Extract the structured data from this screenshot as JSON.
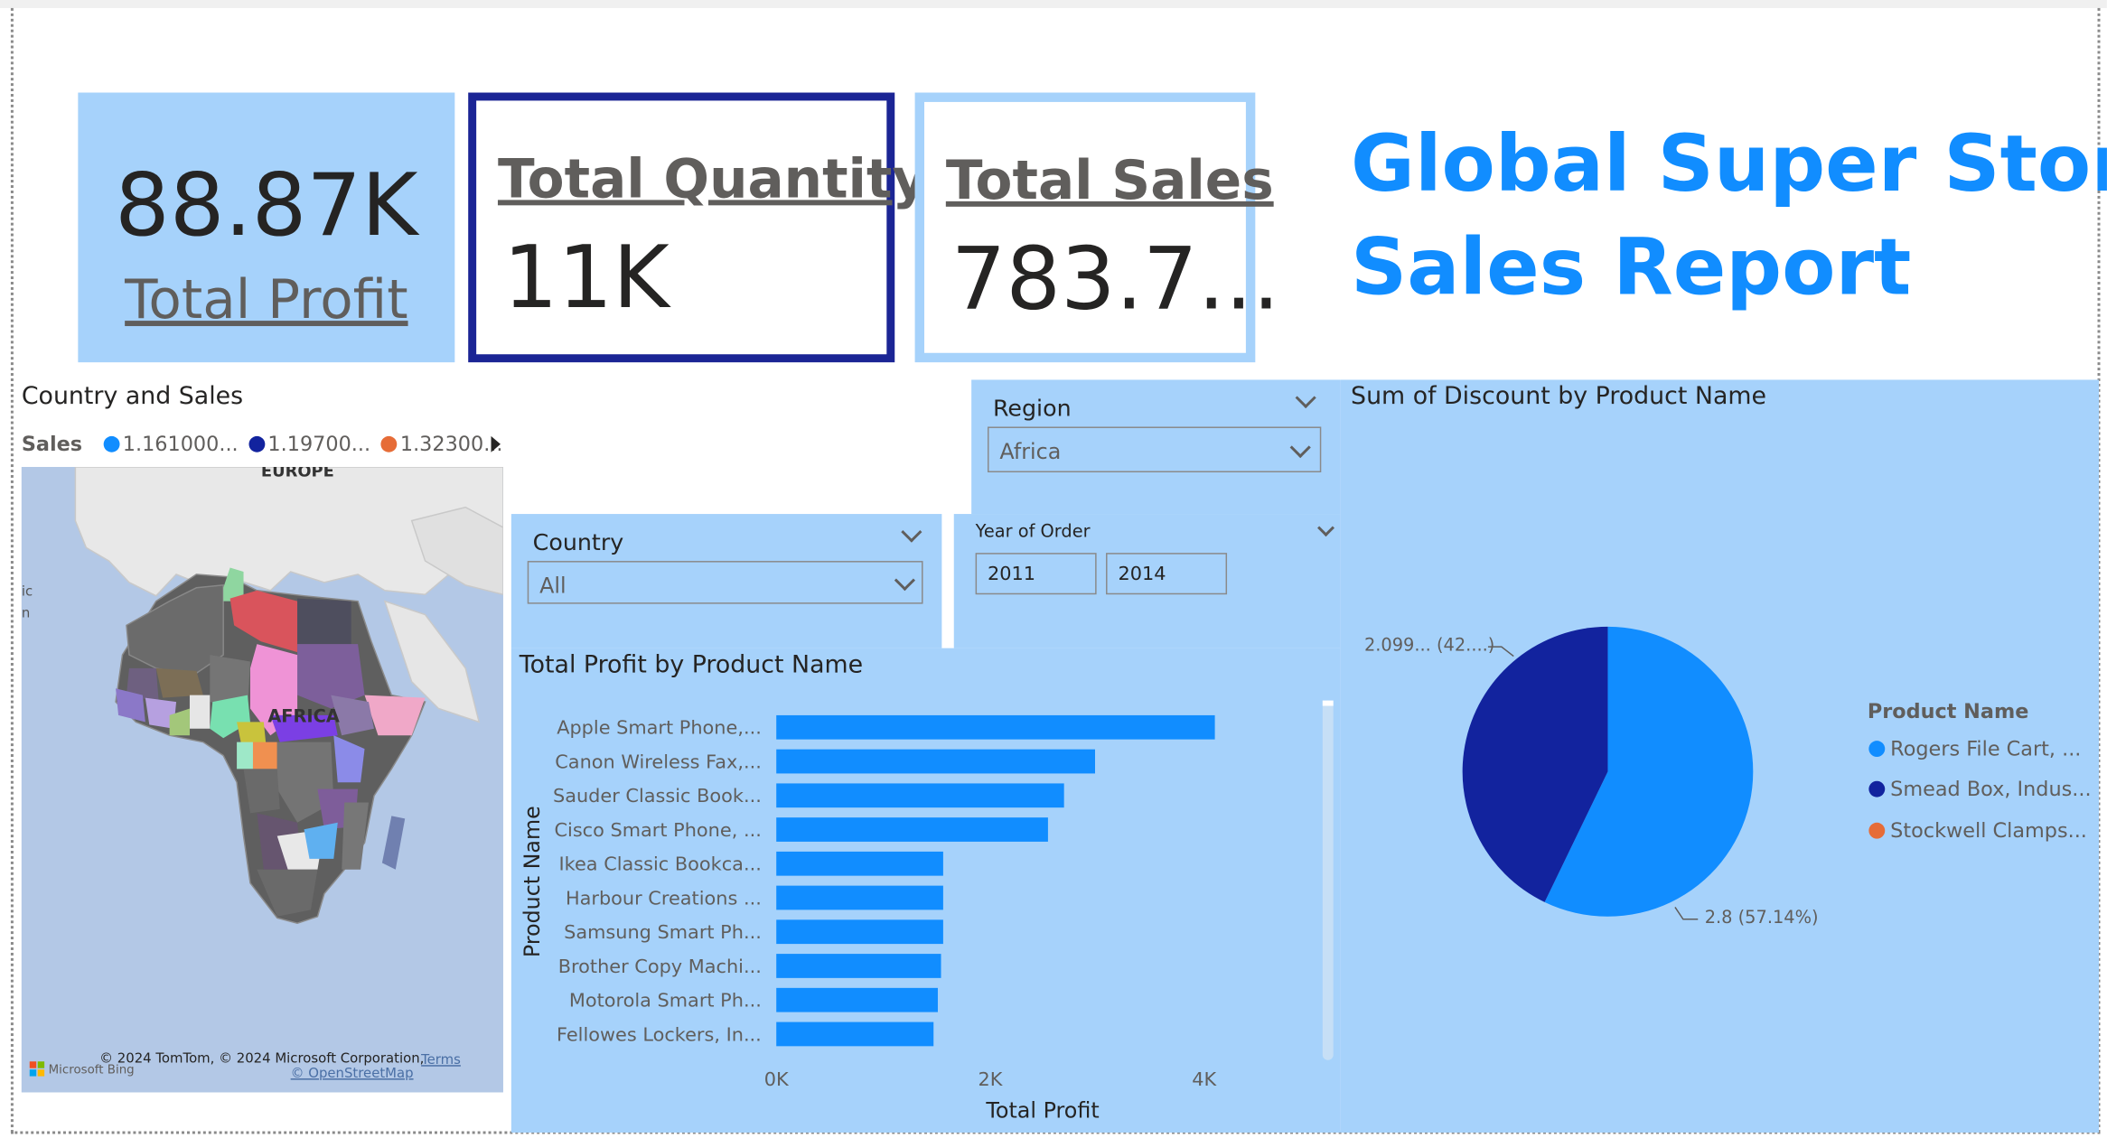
{
  "kpis": {
    "profit": {
      "value": "88.87K",
      "label": "Total Profit"
    },
    "quantity": {
      "label": "Total Quantity",
      "value": "11K"
    },
    "sales": {
      "label": "Total Sales",
      "value": "783.7..."
    }
  },
  "report_title": {
    "line1": "Global Super Store",
    "line2": "Sales Report"
  },
  "slicers": {
    "region": {
      "label": "Region",
      "value": "Africa"
    },
    "country": {
      "label": "Country",
      "value": "All"
    },
    "year": {
      "label": "Year of Order",
      "from": "2011",
      "to": "2014"
    }
  },
  "map": {
    "title": "Country and Sales",
    "legend_title": "Sales",
    "legend": [
      {
        "label": "1.161000...",
        "color": "#118dff"
      },
      {
        "label": "1.19700...",
        "color": "#12239e"
      },
      {
        "label": "1.32300...",
        "color": "#e66c37"
      }
    ],
    "place_labels": {
      "europe": "EUROPE",
      "africa": "AFRICA",
      "edge1": "ic",
      "edge2": "n"
    },
    "attribution": "© 2024 TomTom, © 2024 Microsoft Corporation,",
    "terms": "Terms",
    "osm": "© OpenStreetMap",
    "bing": "Microsoft Bing"
  },
  "bar_chart": {
    "title": "Total Profit by Product Name"
  },
  "pie_chart": {
    "title": "Sum of Discount by Product Name",
    "legend_title": "Product Name",
    "label_a": "2.099... (42....)",
    "label_b": "2.8 (57.14%)"
  },
  "chart_data": [
    {
      "type": "bar",
      "title": "Total Profit by Product Name",
      "orientation": "horizontal",
      "xlabel": "Total Profit",
      "ylabel": "Product Name",
      "xlim": [
        0,
        4000
      ],
      "xticks": [
        "0K",
        "2K",
        "4K"
      ],
      "categories": [
        "Apple Smart Phone,...",
        "Canon Wireless Fax,...",
        "Sauder Classic Book...",
        "Cisco Smart Phone, ...",
        "Ikea Classic Bookca...",
        "Harbour Creations ...",
        "Samsung Smart Ph...",
        "Brother Copy Machi...",
        "Motorola Smart Ph...",
        "Fellowes Lockers, In..."
      ],
      "values": [
        4100,
        2980,
        2690,
        2540,
        1560,
        1560,
        1560,
        1540,
        1510,
        1470
      ],
      "color": "#118dff"
    },
    {
      "type": "pie",
      "title": "Sum of Discount by Product Name",
      "legend_title": "Product Name",
      "categories": [
        "Rogers File Cart, ...",
        "Smead Box, Indus...",
        "Stockwell Clamps..."
      ],
      "values": [
        2.8,
        2.099,
        0
      ],
      "colors": [
        "#118dff",
        "#12239e",
        "#e66c37"
      ],
      "labels": [
        "2.8 (57.14%)",
        "2.099... (42....)",
        ""
      ]
    }
  ]
}
